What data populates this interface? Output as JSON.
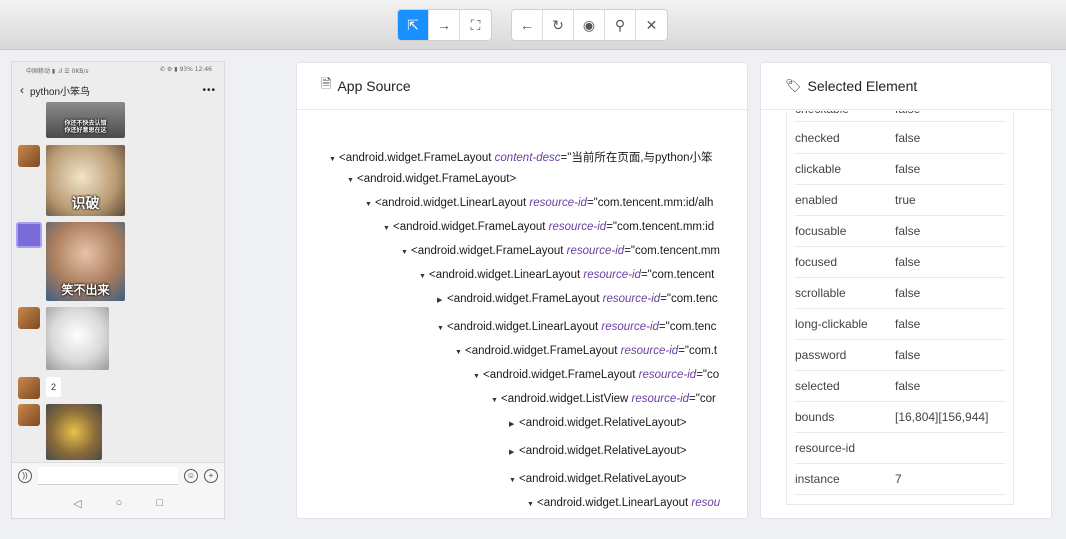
{
  "toolbar": {
    "group1": [
      {
        "name": "select-element-icon",
        "glyph": "⇱"
      },
      {
        "name": "swipe-icon",
        "glyph": "→"
      },
      {
        "name": "tap-coords-icon",
        "glyph": "⛶"
      }
    ],
    "group2": [
      {
        "name": "back-icon",
        "glyph": "←"
      },
      {
        "name": "refresh-icon",
        "glyph": "↻"
      },
      {
        "name": "eye-icon",
        "glyph": "◉"
      },
      {
        "name": "search-icon",
        "glyph": "⚲"
      },
      {
        "name": "close-icon",
        "glyph": "✕"
      }
    ]
  },
  "phone": {
    "status_left": "中国移动 ▮ .ıl ☰ 0KB/s",
    "status_right": "✆ ⚙ ▮ 93% 12:46",
    "chat_title": "python小笨鸟",
    "sticker_captions": {
      "top": "你还不快去认错\n你还好意思在这",
      "cat": "识破",
      "boy": "笑不出来"
    },
    "number_message": "2"
  },
  "source_panel": {
    "title": "App Source",
    "nodes": [
      {
        "caret": "▼",
        "tag": "<android.widget.FrameLayout",
        "attr": "content-desc",
        "val": "=\"当前所在页面,与python小笨"
      },
      {
        "caret": "▼",
        "tag": "<android.widget.FrameLayout>",
        "attr": "",
        "val": ""
      },
      {
        "caret": "▼",
        "tag": "<android.widget.LinearLayout",
        "attr": "resource-id",
        "val": "=\"com.tencent.mm:id/alh"
      },
      {
        "caret": "▼",
        "tag": "<android.widget.FrameLayout",
        "attr": "resource-id",
        "val": "=\"com.tencent.mm:id"
      },
      {
        "caret": "▼",
        "tag": "<android.widget.FrameLayout",
        "attr": "resource-id",
        "val": "=\"com.tencent.mm"
      },
      {
        "caret": "▼",
        "tag": "<android.widget.LinearLayout",
        "attr": "resource-id",
        "val": "=\"com.tencent"
      },
      {
        "caret": "▶",
        "tag": "<android.widget.FrameLayout",
        "attr": "resource-id",
        "val": "=\"com.tenc"
      },
      {
        "caret": "▼",
        "tag": "<android.widget.LinearLayout",
        "attr": "resource-id",
        "val": "=\"com.tenc"
      },
      {
        "caret": "▼",
        "tag": "<android.widget.FrameLayout",
        "attr": "resource-id",
        "val": "=\"com.t"
      },
      {
        "caret": "▼",
        "tag": "<android.widget.FrameLayout",
        "attr": "resource-id",
        "val": "=\"co"
      },
      {
        "caret": "▼",
        "tag": "<android.widget.ListView",
        "attr": "resource-id",
        "val": "=\"cor"
      },
      {
        "caret": "▶",
        "tag": "<android.widget.RelativeLayout>",
        "attr": "",
        "val": ""
      },
      {
        "caret": "▶",
        "tag": "<android.widget.RelativeLayout>",
        "attr": "",
        "val": ""
      },
      {
        "caret": "▼",
        "tag": "<android.widget.RelativeLayout>",
        "attr": "",
        "val": ""
      },
      {
        "caret": "▼",
        "tag": "<android.widget.LinearLayout",
        "attr": "resou",
        "val": ""
      }
    ]
  },
  "selected_panel": {
    "title": "Selected Element",
    "partial_row": {
      "key": "checkable",
      "value": "false"
    },
    "rows": [
      {
        "key": "checked",
        "value": "false"
      },
      {
        "key": "clickable",
        "value": "false"
      },
      {
        "key": "enabled",
        "value": "true"
      },
      {
        "key": "focusable",
        "value": "false"
      },
      {
        "key": "focused",
        "value": "false"
      },
      {
        "key": "scrollable",
        "value": "false"
      },
      {
        "key": "long-clickable",
        "value": "false"
      },
      {
        "key": "password",
        "value": "false"
      },
      {
        "key": "selected",
        "value": "false"
      },
      {
        "key": "bounds",
        "value": "[16,804][156,944]"
      },
      {
        "key": "resource-id",
        "value": ""
      },
      {
        "key": "instance",
        "value": "7"
      }
    ]
  },
  "colors": {
    "accent": "#1890ff",
    "attr": "#6a3fa0"
  }
}
